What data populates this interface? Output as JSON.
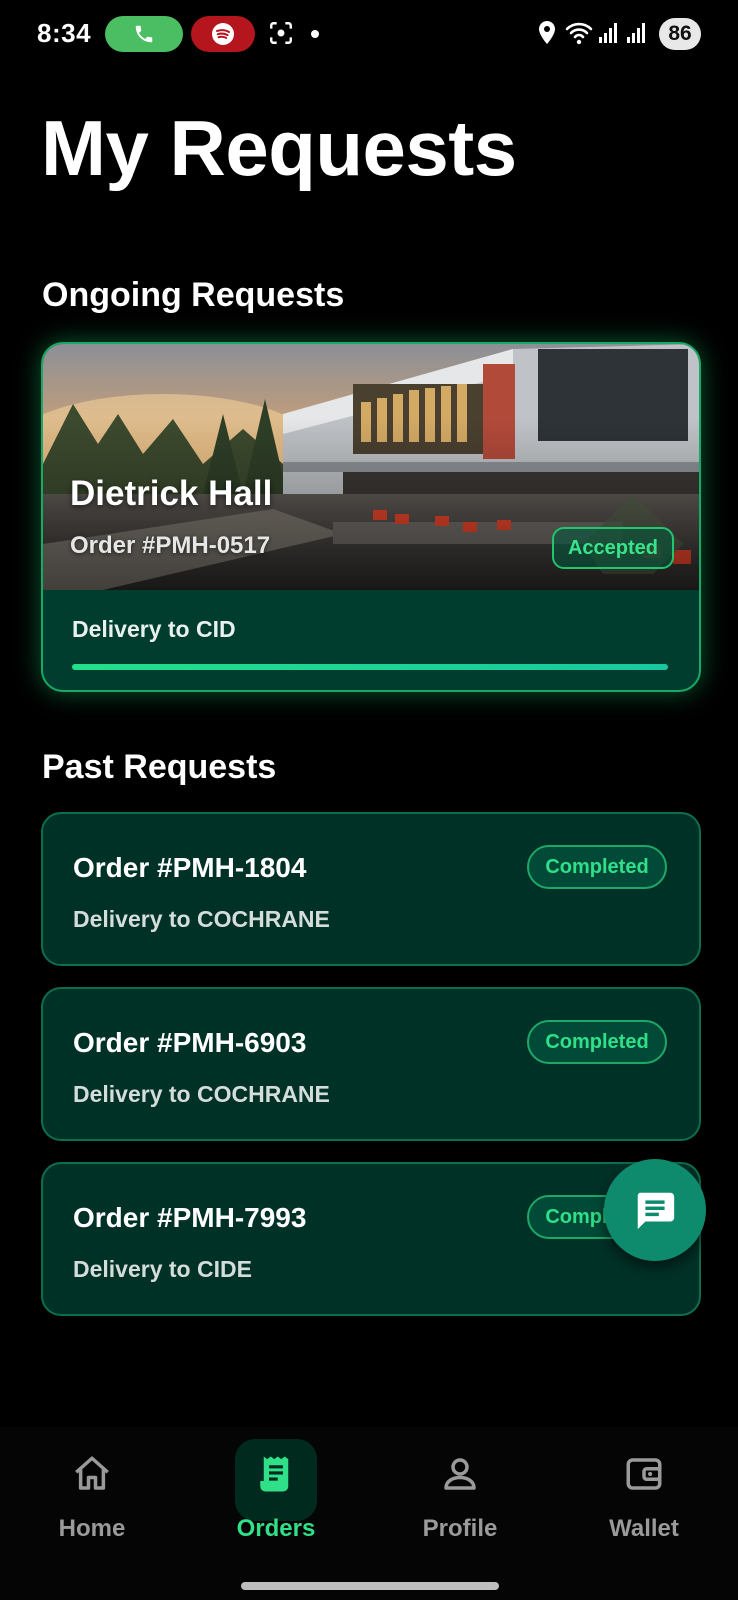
{
  "status_bar": {
    "time": "8:34",
    "battery": "86"
  },
  "page_title": "My Requests",
  "ongoing": {
    "section_title": "Ongoing Requests",
    "card": {
      "location": "Dietrick Hall",
      "order_number": "Order #PMH-0517",
      "status": "Accepted",
      "delivery": "Delivery to CID",
      "progress": 1.0
    }
  },
  "past": {
    "section_title": "Past Requests",
    "items": [
      {
        "order_number": "Order #PMH-1804",
        "delivery": "Delivery to COCHRANE",
        "status": "Completed"
      },
      {
        "order_number": "Order #PMH-6903",
        "delivery": "Delivery to COCHRANE",
        "status": "Completed"
      },
      {
        "order_number": "Order #PMH-7993",
        "delivery": "Delivery to CIDE",
        "status": "Completed"
      }
    ]
  },
  "nav": {
    "active": "Orders",
    "items": [
      {
        "label": "Home",
        "icon": "home-icon"
      },
      {
        "label": "Orders",
        "icon": "receipt-icon"
      },
      {
        "label": "Profile",
        "icon": "person-icon"
      },
      {
        "label": "Wallet",
        "icon": "wallet-icon"
      }
    ]
  },
  "colors": {
    "accent": "#2fe089",
    "card_bg": "#003127",
    "fab": "#0e8a6c"
  }
}
